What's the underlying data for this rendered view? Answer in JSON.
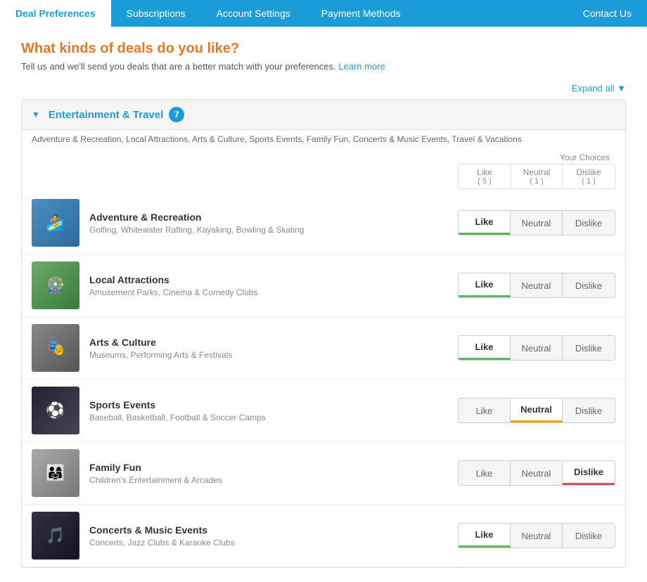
{
  "nav": {
    "items": [
      {
        "id": "deal-preferences",
        "label": "Deal Preferences",
        "active": true
      },
      {
        "id": "subscriptions",
        "label": "Subscriptions",
        "active": false
      },
      {
        "id": "account-settings",
        "label": "Account Settings",
        "active": false
      },
      {
        "id": "payment-methods",
        "label": "Payment Methods",
        "active": false
      },
      {
        "id": "contact-us",
        "label": "Contact Us",
        "active": false
      }
    ]
  },
  "page": {
    "heading": "What kinds of deals do you like?",
    "subtext": "Tell us and we'll send you deals that are a better match with your preferences.",
    "learn_more": "Learn more",
    "expand_all": "Expand all ▼"
  },
  "section": {
    "title": "Entertainment & Travel",
    "count": "7",
    "subcats": "Adventure & Recreation, Local Attractions, Arts & Culture, Sports Events, Family Fun, Concerts & Music Events, Travel & Vacations",
    "your_choices": "Your Choices",
    "col_like": "Like",
    "col_neutral": "Neutral",
    "col_dislike": "Dislike",
    "count_like": "( 5 )",
    "count_neutral": "( 1 )",
    "count_dislike": "( 1 )"
  },
  "categories": [
    {
      "id": "adventure",
      "name": "Adventure & Recreation",
      "desc": "Golfing, Whitewater Rafting, Kayaking, Bowling & Skating",
      "thumb_class": "thumb-adventure",
      "thumb_icon": "🏄",
      "pref": "like"
    },
    {
      "id": "local",
      "name": "Local Attractions",
      "desc": "Amusement Parks, Cinema & Comedy Clubs",
      "thumb_class": "thumb-local",
      "thumb_icon": "🎡",
      "pref": "like"
    },
    {
      "id": "arts",
      "name": "Arts & Culture",
      "desc": "Museums, Performing Arts & Festivals",
      "thumb_class": "thumb-arts",
      "thumb_icon": "🎭",
      "pref": "like"
    },
    {
      "id": "sports",
      "name": "Sports Events",
      "desc": "Baseball, Basketball, Football & Soccer Camps",
      "thumb_class": "thumb-sports",
      "thumb_icon": "⚽",
      "pref": "neutral"
    },
    {
      "id": "family",
      "name": "Family Fun",
      "desc": "Children's Entertainment & Arcades",
      "thumb_class": "thumb-family",
      "thumb_icon": "👨‍👩‍👧",
      "pref": "dislike"
    },
    {
      "id": "concerts",
      "name": "Concerts & Music Events",
      "desc": "Concerts, Jazz Clubs & Karaoke Clubs",
      "thumb_class": "thumb-concerts",
      "thumb_icon": "🎵",
      "pref": "like"
    }
  ],
  "btn_labels": {
    "like": "Like",
    "neutral": "Neutral",
    "dislike": "Dislike"
  }
}
